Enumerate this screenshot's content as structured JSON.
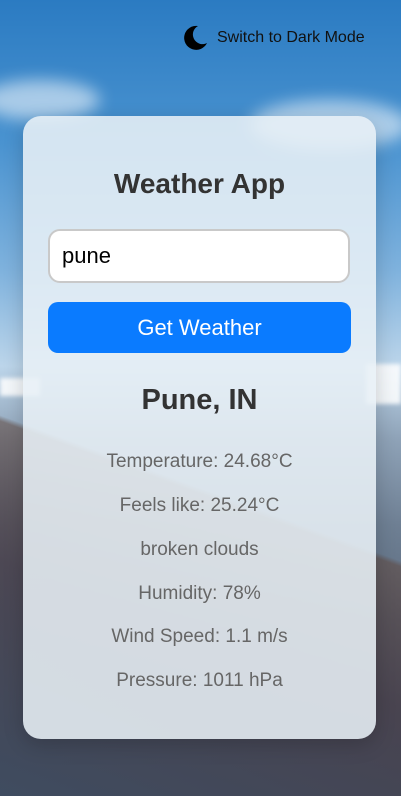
{
  "theme_toggle": {
    "icon": "moon-icon",
    "label": "Switch to Dark Mode"
  },
  "app": {
    "title": "Weather App",
    "search": {
      "value": "pune",
      "button_label": "Get Weather"
    },
    "result": {
      "city": "Pune, IN",
      "temperature": "Temperature: 24.68°C",
      "feels_like": "Feels like: 25.24°C",
      "description": "broken clouds",
      "humidity": "Humidity: 78%",
      "wind_speed": "Wind Speed: 1.1 m/s",
      "pressure": "Pressure: 1011 hPa"
    }
  },
  "colors": {
    "accent": "#0a7bff",
    "card_bg": "#e8f0f6",
    "title_text": "#333333",
    "info_text": "#666666"
  }
}
